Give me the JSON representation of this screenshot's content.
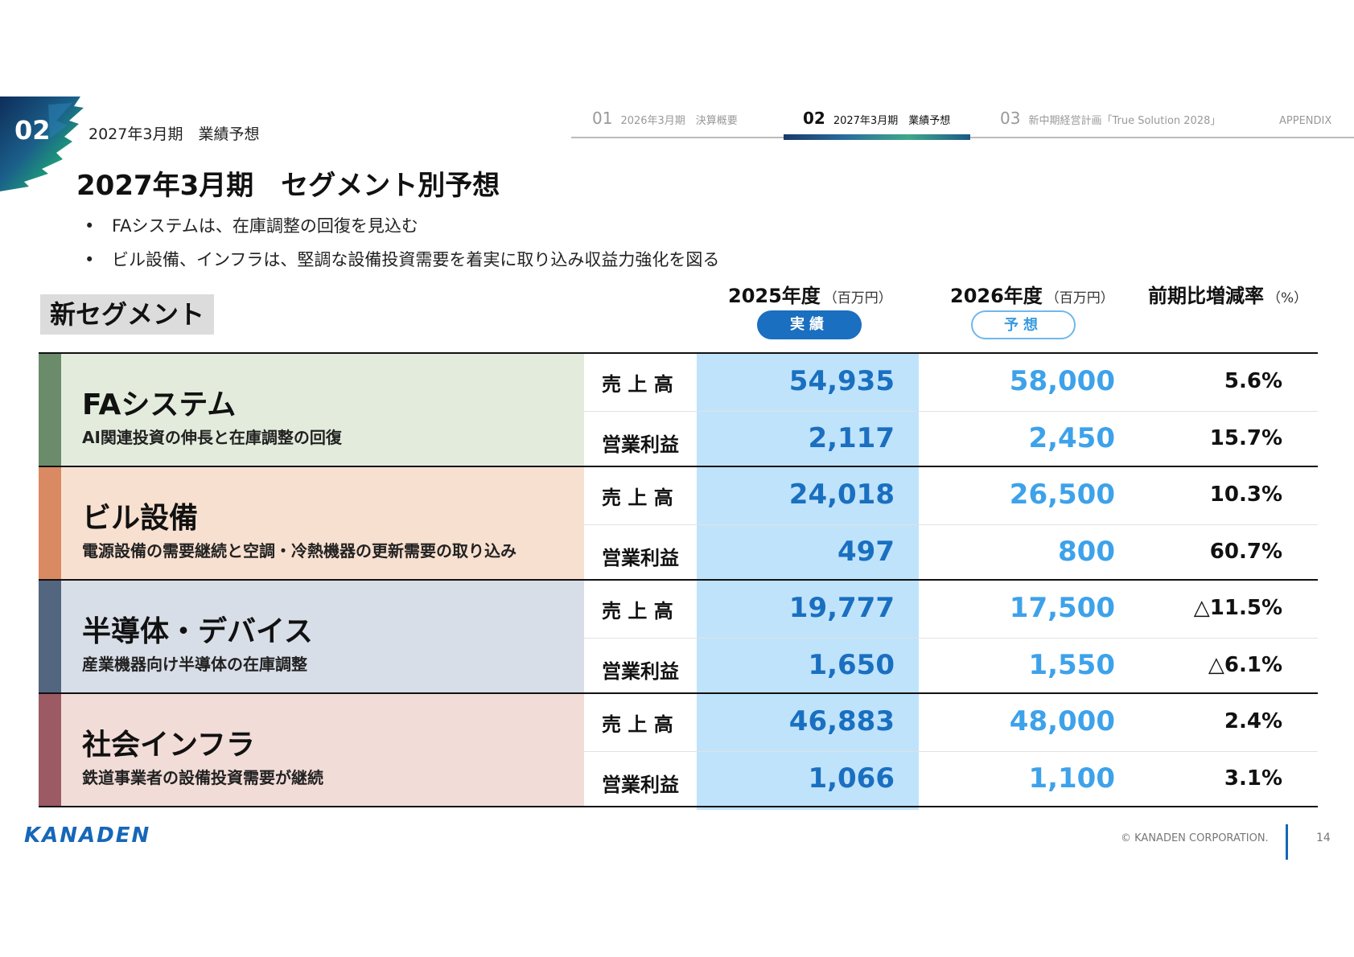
{
  "header": {
    "section_number": "02",
    "section_label": "2027年3月期　業績予想",
    "nav": [
      {
        "num": "01",
        "label": "2026年3月期　決算概要",
        "active": false
      },
      {
        "num": "02",
        "label": "2027年3月期　業績予想",
        "active": true
      },
      {
        "num": "03",
        "label": "新中期経営計画「True Solution 2028」",
        "active": false
      },
      {
        "num": "",
        "label": "APPENDIX",
        "active": false
      }
    ]
  },
  "title": "2027年3月期　セグメント別予想",
  "bullets": [
    "FAシステムは、在庫調整の回復を見込む",
    "ビル設備、インフラは、堅調な設備投資需要を着実に取り込み収益力強化を図る"
  ],
  "bullet_symbol": "•",
  "table": {
    "segment_badge": "新セグメント",
    "col_2025": {
      "label": "2025年度",
      "unit": "（百万円）",
      "pill": "実績"
    },
    "col_2026": {
      "label": "2026年度",
      "unit": "（百万円）",
      "pill": "予想"
    },
    "col_rate": {
      "label": "前期比増減率",
      "unit": "（%）"
    },
    "row_labels": {
      "sales": "売 上 高",
      "profit": "営業利益"
    },
    "segments": [
      {
        "name": "FAシステム",
        "desc": "AI関連投資の伸長と在庫調整の回復",
        "stripe": "#6b8c6a",
        "bg": "#e3ecdc",
        "sales": {
          "y2025": "54,935",
          "y2026": "58,000",
          "rate": "5.6%"
        },
        "profit": {
          "y2025": "2,117",
          "y2026": "2,450",
          "rate": "15.7%"
        }
      },
      {
        "name": "ビル設備",
        "desc": "電源設備の需要継続と空調・冷熱機器の更新需要の取り込み",
        "stripe": "#d98a62",
        "bg": "#f8e0d0",
        "sales": {
          "y2025": "24,018",
          "y2026": "26,500",
          "rate": "10.3%"
        },
        "profit": {
          "y2025": "497",
          "y2026": "800",
          "rate": "60.7%"
        }
      },
      {
        "name": "半導体・デバイス",
        "desc": "産業機器向け半導体の在庫調整",
        "stripe": "#536680",
        "bg": "#d8dee8",
        "sales": {
          "y2025": "19,777",
          "y2026": "17,500",
          "rate": "△11.5%"
        },
        "profit": {
          "y2025": "1,650",
          "y2026": "1,550",
          "rate": "△6.1%"
        }
      },
      {
        "name": "社会インフラ",
        "desc": "鉄道事業者の設備投資需要が継続",
        "stripe": "#9c5a64",
        "bg": "#f2dcd8",
        "sales": {
          "y2025": "46,883",
          "y2026": "48,000",
          "rate": "2.4%"
        },
        "profit": {
          "y2025": "1,066",
          "y2026": "1,100",
          "rate": "3.1%"
        }
      }
    ]
  },
  "footer": {
    "logo": "KANADEN",
    "copyright": "© KANADEN CORPORATION.",
    "page": "14"
  },
  "colors": {
    "accent_blue": "#1a6fc0",
    "forecast_blue": "#3da2ea",
    "actual_column_bg": "#bfe3fb"
  }
}
